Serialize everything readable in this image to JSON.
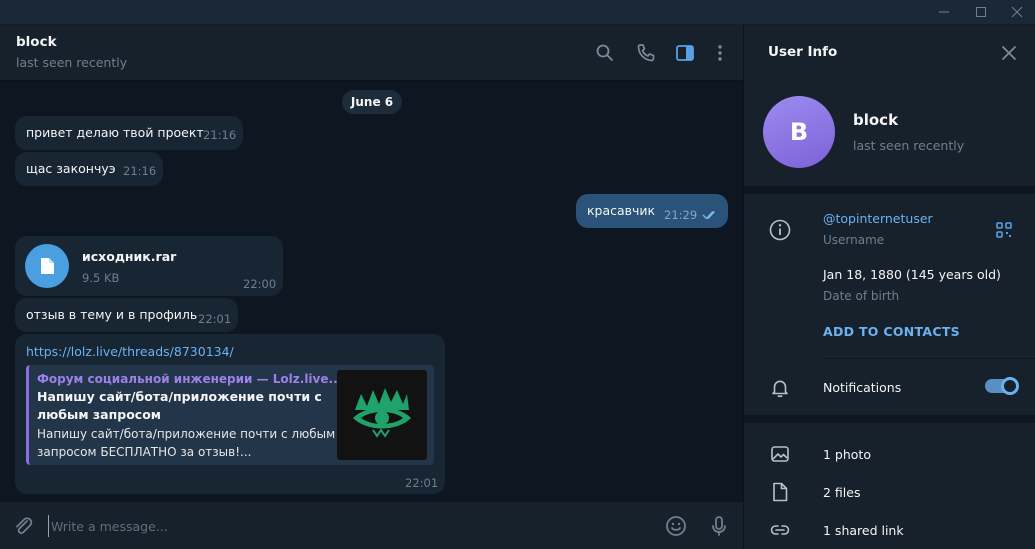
{
  "chat": {
    "title": "block",
    "status": "last seen recently",
    "date_label": "June 6",
    "messages": [
      {
        "text": "привет делаю твой проект",
        "time": "21:16"
      },
      {
        "text": "щас закончуэ",
        "time": "21:16"
      },
      {
        "text": "красавчик",
        "time": "21:29"
      },
      {
        "file_name": "исходник.rar",
        "file_size": "9.5 KB",
        "time": "22:00"
      },
      {
        "text": "отзыв в тему и в профиль",
        "time": "22:01"
      },
      {
        "link": "https://lolz.live/threads/8730134/",
        "preview_site": "Форум социальной инженерии — Lolz.live...",
        "preview_title": "Напишу сайт/бота/приложение почти с любым запросом",
        "preview_desc": "Напишу сайт/бота/приложение почти с любым запросом БЕСПЛАТНО за отзыв!...",
        "time": "22:01"
      }
    ],
    "composer_placeholder": "Write a message..."
  },
  "info": {
    "title": "User Info",
    "avatar_letter": "B",
    "name": "block",
    "status": "last seen recently",
    "username": "@topinternetuser",
    "username_label": "Username",
    "birth_date": "Jan 18, 1880 (145 years old)",
    "birth_label": "Date of birth",
    "add_contact": "ADD TO CONTACTS",
    "notifications_label": "Notifications",
    "notifications_on": true,
    "photos": "1 photo",
    "files": "2 files",
    "links": "1 shared link"
  },
  "colors": {
    "background": "#0e1621",
    "panel": "#17212b",
    "incoming_bubble": "#182533",
    "outgoing_bubble": "#2b5278",
    "accent": "#6ab2f2",
    "avatar": "#8c74e4"
  },
  "icons": [
    "minimize-icon",
    "maximize-icon",
    "close-icon",
    "search-icon",
    "phone-icon",
    "sidebar-toggle-icon",
    "more-icon",
    "file-icon",
    "double-check-icon",
    "attach-icon",
    "emoji-icon",
    "microphone-icon",
    "info-icon",
    "qr-code-icon",
    "bell-icon",
    "photo-icon",
    "files-icon",
    "link-icon"
  ]
}
